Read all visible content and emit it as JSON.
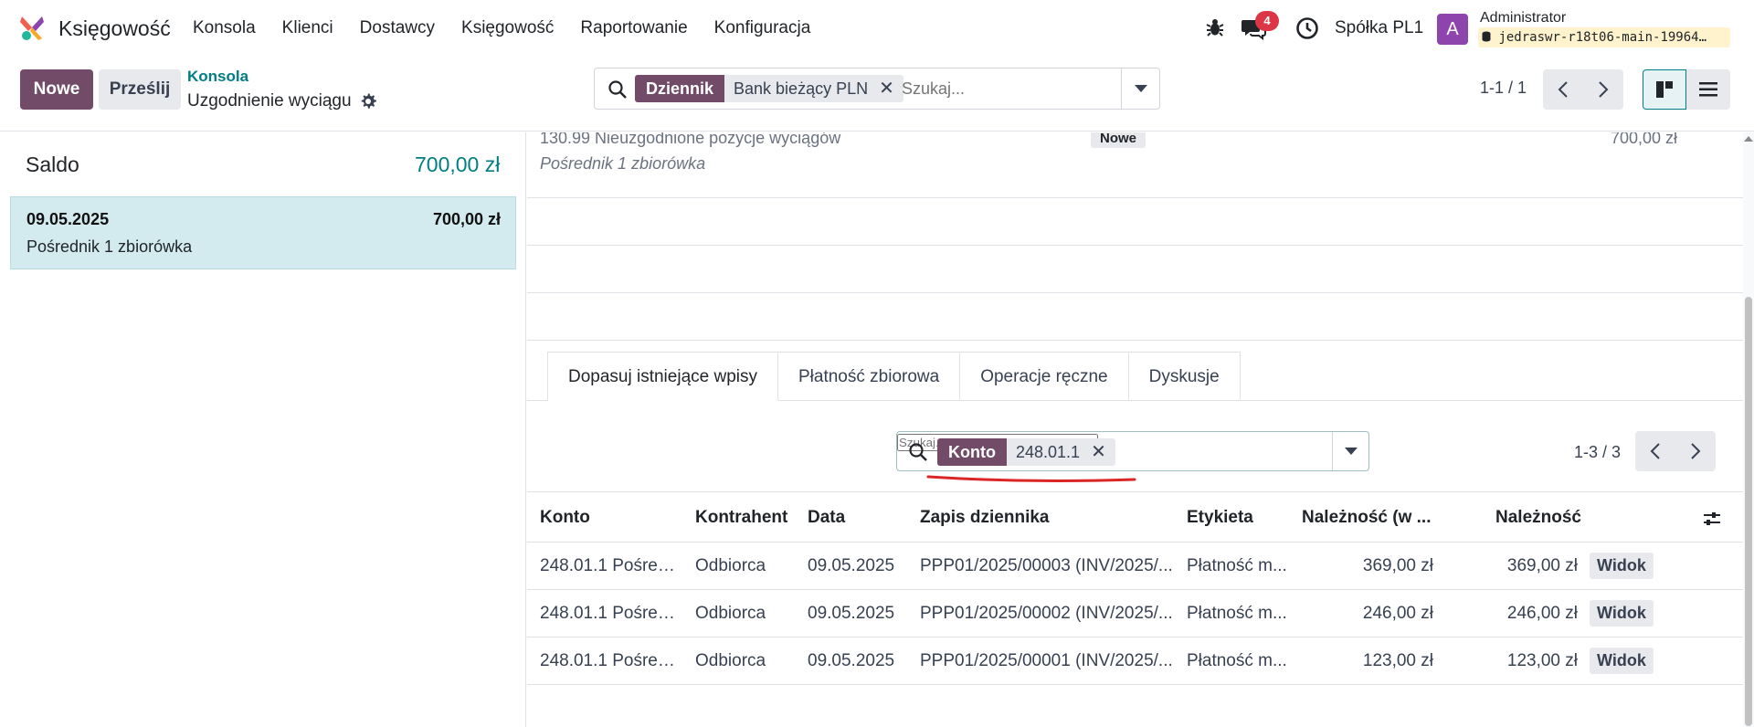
{
  "navbar": {
    "app_name": "Księgowość",
    "menu": [
      "Konsola",
      "Klienci",
      "Dostawcy",
      "Księgowość",
      "Raportowanie",
      "Konfiguracja"
    ],
    "messages_count": "4",
    "company": "Spółka PL1",
    "avatar_letter": "A",
    "user_name": "Administrator",
    "db_name": "jedraswr-r18t06-main-19964…"
  },
  "control_panel": {
    "new_label": "Nowe",
    "upload_label": "Prześlij",
    "breadcrumb_parent": "Konsola",
    "breadcrumb_current": "Uzgodnienie wyciągu",
    "search": {
      "facet_key": "Dziennik",
      "facet_value": "Bank bieżący PLN",
      "placeholder": "Szukaj..."
    },
    "pager": "1-1 / 1"
  },
  "left_panel": {
    "saldo_label": "Saldo",
    "saldo_value": "700,00 zł",
    "line": {
      "date": "09.05.2025",
      "amount": "700,00 zł",
      "partner": "Pośrednik 1 zbiorówka"
    }
  },
  "right_panel": {
    "top_line": {
      "name": "130.99 Nieuzgodnione pozycje wyciągów",
      "partner": "Pośrednik 1 zbiorówka",
      "badge": "Nowe",
      "amount": "700,00 zł"
    },
    "tabs": [
      "Dopasuj istniejące wpisy",
      "Płatność zbiorowa",
      "Operacje ręczne",
      "Dyskusje"
    ],
    "search": {
      "facet_key": "Konto",
      "facet_value": "248.01.1",
      "placeholder": "Szukaj..."
    },
    "pager": "1-3 / 3",
    "columns": [
      "Konto",
      "Kontrahent",
      "Data",
      "Zapis dziennika",
      "Etykieta",
      "Należność (w ...",
      "Należność"
    ],
    "rows": [
      {
        "konto": "248.01.1 Pośred...",
        "kontrahent": "Odbiorca",
        "data": "09.05.2025",
        "zapis": "PPP01/2025/00003 (INV/2025/...",
        "etykieta": "Płatność m...",
        "nal_w": "369,00 zł",
        "nal": "369,00 zł",
        "action": "Widok"
      },
      {
        "konto": "248.01.1 Pośred...",
        "kontrahent": "Odbiorca",
        "data": "09.05.2025",
        "zapis": "PPP01/2025/00002 (INV/2025/...",
        "etykieta": "Płatność m...",
        "nal_w": "246,00 zł",
        "nal": "246,00 zł",
        "action": "Widok"
      },
      {
        "konto": "248.01.1 Pośred...",
        "kontrahent": "Odbiorca",
        "data": "09.05.2025",
        "zapis": "PPP01/2025/00001 (INV/2025/...",
        "etykieta": "Płatność m...",
        "nal_w": "123,00 zł",
        "nal": "123,00 zł",
        "action": "Widok"
      }
    ]
  },
  "colors": {
    "primary": "#714B67",
    "accent": "#017e84",
    "selected_line": "#d3ebef",
    "badge": "#dc3545"
  }
}
